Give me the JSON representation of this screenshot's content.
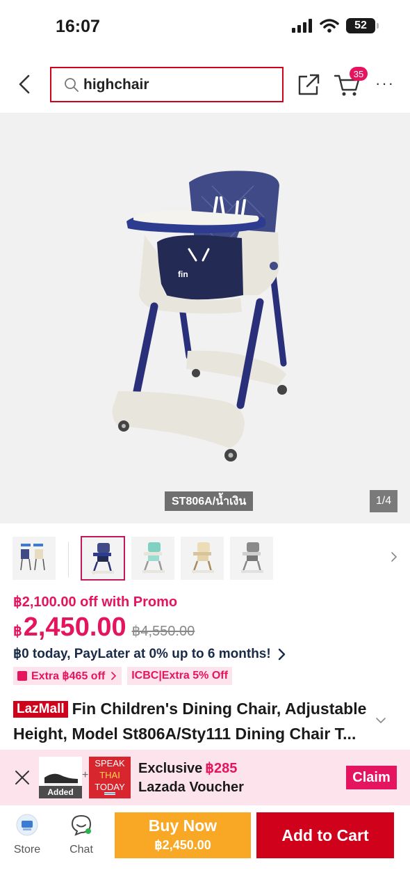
{
  "status_bar": {
    "time": "16:07",
    "battery": "52"
  },
  "header": {
    "search_value": "highchair",
    "cart_count": "35",
    "more_label": "···"
  },
  "product": {
    "variant_label": "ST806A/น้ำเงิน",
    "image_counter": "1/4",
    "chair_colors": {
      "seat": "#3f4a86",
      "frame": "#e8e5dc",
      "legs": "#2a2f7a",
      "tray": "#2e3c8f"
    }
  },
  "thumbnails": [
    {
      "name": "variant-pair",
      "selected": false
    },
    {
      "name": "navy",
      "selected": true
    },
    {
      "name": "mint",
      "selected": false
    },
    {
      "name": "beige",
      "selected": false
    },
    {
      "name": "grey",
      "selected": false
    }
  ],
  "pricing": {
    "promo": "฿2,100.00 off with Promo",
    "currency": "฿",
    "price": "2,450.00",
    "original_price": "฿4,550.00",
    "paylater": "฿0 today, PayLater at 0% up to 6 months!",
    "badges": [
      "Extra ฿465 off",
      "ICBC|Extra 5% Off"
    ]
  },
  "title": {
    "store_badge": "LazMall",
    "text": "Fin Children's Dining Chair, Adjustable Height, Model St806A/Sty111 Dining Chair T..."
  },
  "voucher": {
    "added_label": "Added",
    "speak_line1": "SPEAK",
    "speak_line2": "THAI",
    "speak_line3": "TODAY",
    "exclusive_label": "Exclusive",
    "amount": "฿285",
    "line2": "Lazada Voucher",
    "claim_label": "Claim"
  },
  "bottom_bar": {
    "store_label": "Store",
    "chat_label": "Chat",
    "buy_now_label": "Buy Now",
    "buy_now_price": "฿2,450.00",
    "add_to_cart_label": "Add to Cart"
  },
  "colors": {
    "accent_pink": "#e5145f",
    "lazada_red": "#d0021b",
    "buy_now_orange": "#f9a825"
  }
}
